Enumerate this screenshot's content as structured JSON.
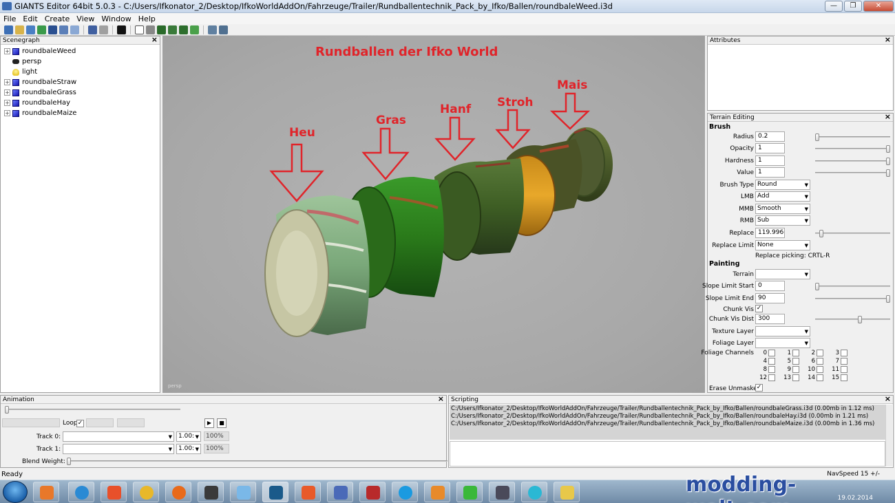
{
  "window": {
    "title": "GIANTS Editor 64bit 5.0.3 - C:/Users/Ifkonator_2/Desktop/IfkoWorldAddOn/Fahrzeuge/Trailer/Rundballentechnik_Pack_by_Ifko/Ballen/roundbaleWeed.i3d",
    "min": "—",
    "max": "❐",
    "close": "✕"
  },
  "menu": [
    "File",
    "Edit",
    "Create",
    "View",
    "Window",
    "Help"
  ],
  "scenegraph": {
    "title": "Scenegraph",
    "items": [
      {
        "label": "roundbaleWeed",
        "icon": "cube-icon",
        "expandable": true
      },
      {
        "label": "persp",
        "icon": "camera-icon",
        "expandable": false
      },
      {
        "label": "light",
        "icon": "light-bulb-icon",
        "expandable": false
      },
      {
        "label": "roundbaleStraw",
        "icon": "cube-icon",
        "expandable": true
      },
      {
        "label": "roundbaleGrass",
        "icon": "cube-icon",
        "expandable": true
      },
      {
        "label": "roundbaleHay",
        "icon": "cube-icon",
        "expandable": true
      },
      {
        "label": "roundbaleMaize",
        "icon": "cube-icon",
        "expandable": true
      }
    ]
  },
  "viewport": {
    "heading": "Rundballen der Ifko World",
    "labels": [
      "Heu",
      "Gras",
      "Hanf",
      "Stroh",
      "Mais"
    ],
    "camera": "persp",
    "accent": "#e0242a"
  },
  "attributes": {
    "title": "Attributes"
  },
  "terrain": {
    "title": "Terrain Editing",
    "brush_heading": "Brush",
    "radius_label": "Radius",
    "radius": "0.2",
    "opacity_label": "Opacity",
    "opacity": "1",
    "hardness_label": "Hardness",
    "hardness": "1",
    "value_label": "Value",
    "value": "1",
    "brush_type_label": "Brush Type",
    "brush_type": "Round",
    "lmb_label": "LMB",
    "lmb": "Add",
    "mmb_label": "MMB",
    "mmb": "Smooth",
    "rmb_label": "RMB",
    "rmb": "Sub",
    "replace_label": "Replace",
    "replace": "119.99609",
    "replace_limit_label": "Replace Limit",
    "replace_limit": "None",
    "replace_picking": "Replace picking: CRTL-R",
    "painting_heading": "Painting",
    "terrain_label": "Terrain",
    "terrain_value": "",
    "slope_start_label": "Slope Limit Start",
    "slope_start": "0",
    "slope_end_label": "Slope Limit End",
    "slope_end": "90",
    "chunk_vis_label": "Chunk Vis",
    "chunk_vis_dist_label": "Chunk Vis Dist",
    "chunk_vis_dist": "300",
    "texture_layer_label": "Texture Layer",
    "texture_layer": "",
    "foliage_layer_label": "Foliage Layer",
    "foliage_layer": "",
    "foliage_channels_label": "Foliage Channels",
    "foliage_channels": [
      "0",
      "1",
      "2",
      "3",
      "4",
      "5",
      "6",
      "7",
      "8",
      "9",
      "10",
      "11",
      "12",
      "13",
      "14",
      "15"
    ],
    "erase_unmasked_label": "Erase Unmasked"
  },
  "animation": {
    "title": "Animation",
    "loop_label": "Loop",
    "track0_label": "Track 0:",
    "track1_label": "Track 1:",
    "speed0": "1.00:",
    "speed1": "1.00:",
    "weight0": "100%",
    "weight1": "100%",
    "blend_label": "Blend Weight:"
  },
  "scripting": {
    "title": "Scripting",
    "lines": [
      "C:/Users/Ifkonator_2/Desktop/IfkoWorldAddOn/Fahrzeuge/Trailer/Rundballentechnik_Pack_by_Ifko/Ballen/roundbaleGrass.i3d (0.00mb in 1.12 ms)",
      "C:/Users/Ifkonator_2/Desktop/IfkoWorldAddOn/Fahrzeuge/Trailer/Rundballentechnik_Pack_by_Ifko/Ballen/roundbaleHay.i3d (0.00mb in 1.21 ms)",
      "C:/Users/Ifkonator_2/Desktop/IfkoWorldAddOn/Fahrzeuge/Trailer/Rundballentechnik_Pack_by_Ifko/Ballen/roundbaleMaize.i3d (0.00mb in 1.36 ms)"
    ]
  },
  "status": {
    "text": "Ready",
    "navspeed": "NavSpeed 15 +/-"
  },
  "taskbar": {
    "watermark": "modding-welt.com",
    "date": "19.02.2014",
    "apps": [
      "media-player-icon",
      "internet-explorer-icon",
      "app-3-icon",
      "network-icon",
      "firefox-icon",
      "terminal-icon",
      "paint-icon",
      "giants-editor-icon",
      "game-icon",
      "tool-icon",
      "tractor-icon",
      "skype-icon",
      "brush-icon",
      "clover-icon",
      "truck-icon",
      "headset-icon",
      "folder-icon"
    ]
  }
}
